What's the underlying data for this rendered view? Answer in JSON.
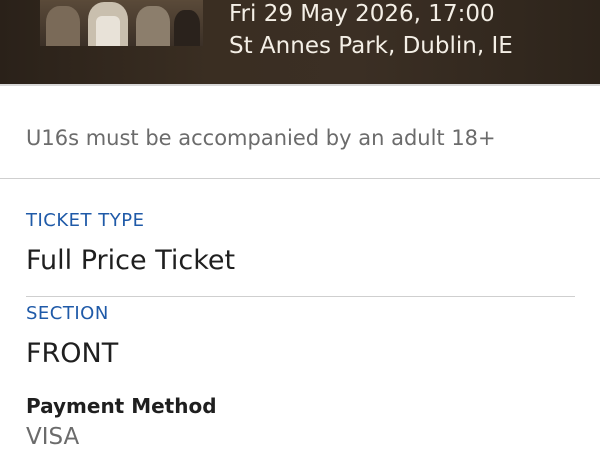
{
  "event": {
    "date_time": "Fri 29 May 2026, 17:00",
    "venue": "St Annes Park, Dublin, IE"
  },
  "notice": {
    "text": "U16s must be accompanied by an adult 18+"
  },
  "ticket": {
    "type_label": "TICKET TYPE",
    "type_value": "Full Price Ticket",
    "section_label": "SECTION",
    "section_value": "FRONT",
    "payment_label": "Payment Method",
    "payment_value": "VISA"
  },
  "colors": {
    "label_accent": "#1f5aa8",
    "header_bg": "#3a2e22",
    "muted_text": "#6b6b6b"
  }
}
